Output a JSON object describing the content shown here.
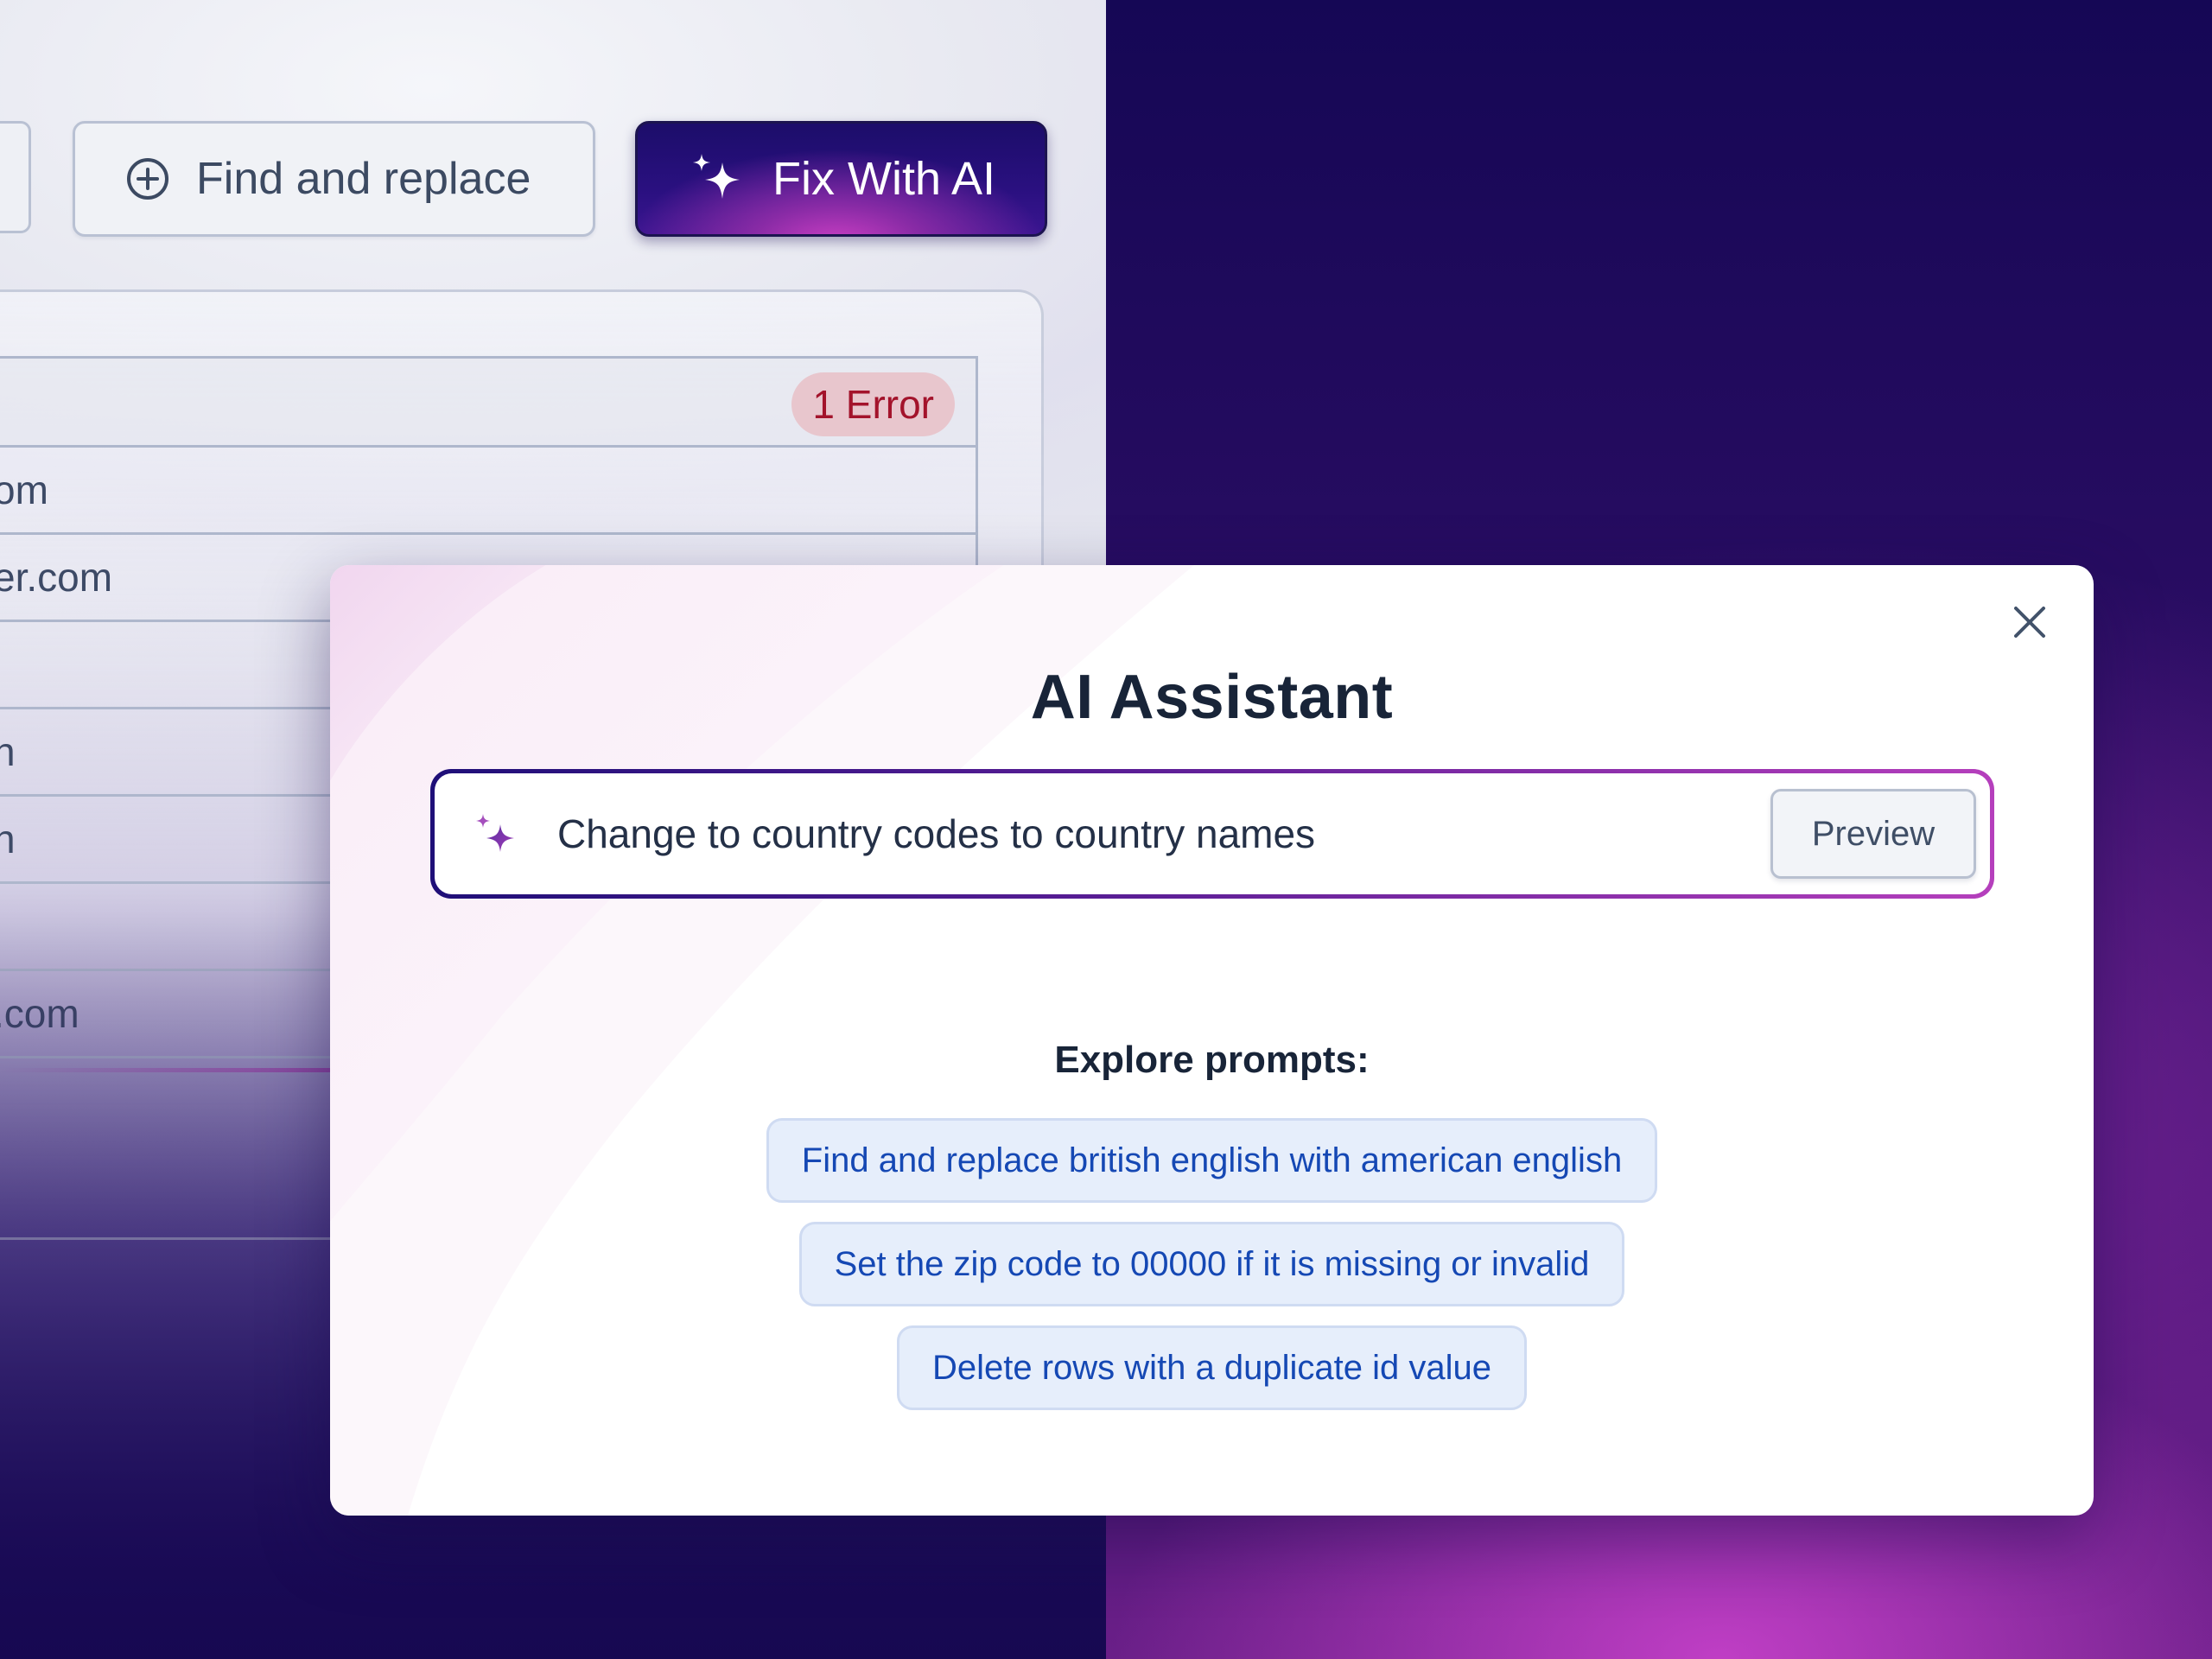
{
  "toolbar": {
    "find_replace_label": "Find and replace",
    "fix_ai_label": "Fix With AI"
  },
  "table": {
    "error_badge": "1 Error",
    "rows": [
      "om",
      "er.com",
      "",
      "n",
      "n",
      "",
      ".com"
    ]
  },
  "modal": {
    "title": "AI Assistant",
    "prompt_value": "Change to country codes to country names",
    "preview_label": "Preview",
    "explore_label": "Explore prompts:",
    "suggestions": [
      "Find and replace british english with american english",
      "Set the zip code to 00000 if it is missing or invalid",
      "Delete rows with a duplicate id value"
    ]
  },
  "icons": {
    "find_replace": "crosshair-icon",
    "fix_ai": "sparkle-icon",
    "prompt": "sparkle-icon",
    "close": "close-icon"
  },
  "colors": {
    "accent_purple": "#b53fbc",
    "deep_indigo": "#1f0f78",
    "error_text": "#a3132b",
    "error_bg": "#e8c6cd",
    "chip_text": "#1548b4",
    "chip_bg": "#e6eefb",
    "title_text": "#182438"
  }
}
